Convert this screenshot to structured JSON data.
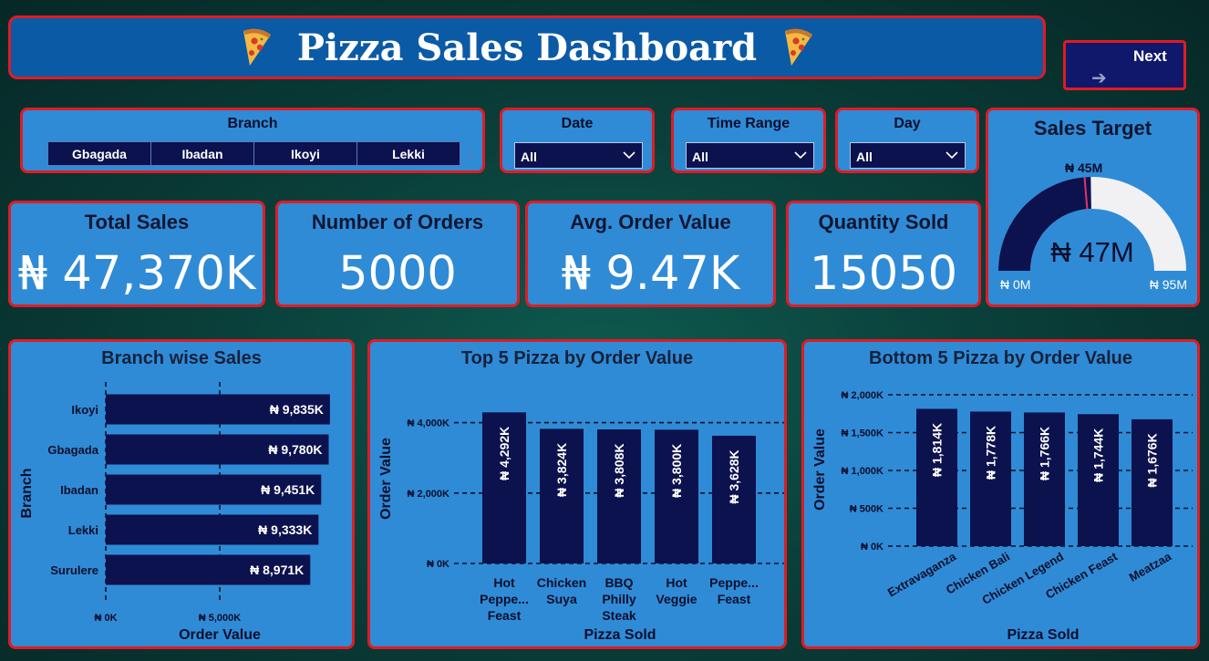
{
  "header": {
    "title": "Pizza Sales Dashboard"
  },
  "icons": {
    "title_decoration": "pizza-slice-icon",
    "next": "arrow-right-icon",
    "dropdown": "chevron-down-icon",
    "scroll": "chevron-right-icon"
  },
  "next_button": {
    "label": "Next",
    "arrow": "➔"
  },
  "filters": {
    "branch": {
      "title": "Branch",
      "options": [
        "Gbagada",
        "Ibadan",
        "Ikoyi",
        "Lekki"
      ],
      "scroll_glyph": "›"
    },
    "date": {
      "title": "Date",
      "value": "All"
    },
    "time_range": {
      "title": "Time Range",
      "value": "All"
    },
    "day": {
      "title": "Day",
      "value": "All"
    }
  },
  "kpis": {
    "total_sales": {
      "title": "Total Sales",
      "value": "₦ 47,370K"
    },
    "orders": {
      "title": "Number of Orders",
      "value": "5000"
    },
    "avg_order": {
      "title": "Avg. Order Value",
      "value": "₦ 9.47K"
    },
    "quantity": {
      "title": "Quantity Sold",
      "value": "15050"
    }
  },
  "sales_target": {
    "title": "Sales Target",
    "value_label": "₦ 47M",
    "target_label": "₦ 45M",
    "min_label": "₦ 0M",
    "max_label": "₦ 95M",
    "value": 47,
    "target": 45,
    "min": 0,
    "max": 95
  },
  "colors": {
    "bar": "#0c124e",
    "card": "#2f8bd6",
    "border": "#e01b24",
    "gauge_fill": "#0c124e",
    "gauge_empty": "#f1f1f3",
    "target_line": "#e0356a"
  },
  "chart_data": [
    {
      "id": "branch_sales",
      "type": "bar",
      "orientation": "horizontal",
      "title": "Branch wise Sales",
      "xlabel": "Order Value",
      "ylabel": "Branch",
      "categories": [
        "Ikoyi",
        "Gbagada",
        "Ibadan",
        "Lekki",
        "Surulere"
      ],
      "values": [
        9835,
        9780,
        9451,
        9333,
        8971
      ],
      "data_labels": [
        "₦ 9,835K",
        "₦ 9,780K",
        "₦ 9,451K",
        "₦ 9,333K",
        "₦ 8,971K"
      ],
      "ticks": [
        0,
        5000
      ],
      "tick_labels": [
        "₦ 0K",
        "₦ 5,000K"
      ],
      "xlim": [
        0,
        10000
      ],
      "grid": true
    },
    {
      "id": "top5",
      "type": "bar",
      "title": "Top 5 Pizza by Order Value",
      "xlabel": "Pizza Sold",
      "ylabel": "Order Value",
      "categories": [
        "Hot Peppe... Feast",
        "Chicken Suya",
        "BBQ Philly Steak",
        "Hot Veggie",
        "Peppe... Feast"
      ],
      "category_lines": [
        [
          "Hot",
          "Peppe...",
          "Feast"
        ],
        [
          "Chicken",
          "Suya"
        ],
        [
          "BBQ",
          "Philly",
          "Steak"
        ],
        [
          "Hot",
          "Veggie"
        ],
        [
          "Peppe...",
          "Feast"
        ]
      ],
      "values": [
        4292,
        3824,
        3808,
        3800,
        3628
      ],
      "data_labels": [
        "₦ 4,292K",
        "₦ 3,824K",
        "₦ 3,808K",
        "₦ 3,800K",
        "₦ 3,628K"
      ],
      "ticks": [
        0,
        2000,
        4000
      ],
      "tick_labels": [
        "₦ 0K",
        "₦ 2,000K",
        "₦ 4,000K"
      ],
      "ylim": [
        0,
        4300
      ],
      "grid": true
    },
    {
      "id": "bottom5",
      "type": "bar",
      "title": "Bottom 5 Pizza by Order Value",
      "xlabel": "Pizza Sold",
      "ylabel": "Order Value",
      "categories": [
        "Extravaganza",
        "Chicken Bali",
        "Chicken Legend",
        "Chicken Feast",
        "Meatzaa"
      ],
      "values": [
        1814,
        1778,
        1766,
        1744,
        1676
      ],
      "data_labels": [
        "₦ 1,814K",
        "₦ 1,778K",
        "₦ 1,766K",
        "₦ 1,744K",
        "₦ 1,676K"
      ],
      "ticks": [
        0,
        500,
        1000,
        1500,
        2000
      ],
      "tick_labels": [
        "₦ 0K",
        "₦ 500K",
        "₦ 1,000K",
        "₦ 1,500K",
        "₦ 2,000K"
      ],
      "ylim": [
        0,
        2000
      ],
      "grid": true
    }
  ]
}
